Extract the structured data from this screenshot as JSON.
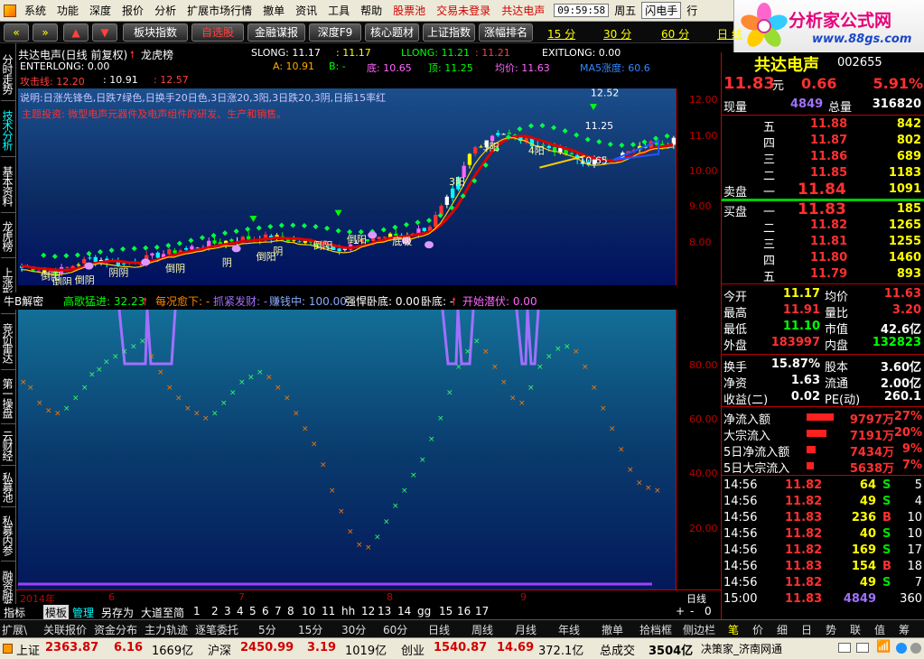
{
  "menubar": {
    "items": [
      "系统",
      "功能",
      "深度",
      "报价",
      "分析",
      "扩展市场行情",
      "撤单",
      "资讯",
      "工具",
      "帮助"
    ],
    "right_items": [
      "股票池",
      "交易未登录",
      "共达电声"
    ],
    "clock": "09:59:58",
    "weekday": "周五",
    "flash": "闪电手",
    "extra": "行"
  },
  "logo": {
    "title": "分析家公式网",
    "url": "www.88gs.com"
  },
  "toolbar": {
    "buttons": [
      "板块指数",
      "自选股",
      "金融谋报",
      "深度F9",
      "核心题材",
      "上证指数",
      "涨幅排名"
    ],
    "periods": [
      "15 分",
      "30 分",
      "60 分",
      "日 线"
    ]
  },
  "left_tabs": [
    "分时走势",
    "技术分析",
    "基本资料",
    "龙虎榜",
    "上涨形态",
    "竞价雷达",
    "第一操盘",
    "云财经",
    "私募池",
    "私募内参",
    "融资融券"
  ],
  "chart_header": {
    "title": "共达电声(日线 前复权)",
    "tag": "龙虎榜",
    "enterlong": "ENTERLONG: 0.00",
    "slong": "SLONG: 11.17",
    "slong2": ": 11.17",
    "llong": "LLONG: 11.21",
    "llong2": ": 11.21",
    "exitlong": "EXITLONG: 0.00",
    "atk": "攻击线: 12.20",
    "atk2": ": 10.91",
    "atk3": ": 12.57",
    "a": "A: 10.91",
    "b": "B: -",
    "low": "底: 10.65",
    "top": "顶: 11.25",
    "avg": "均价: 11.63",
    "ma5": "MA5涨度: 60.6",
    "note1": "说明:日涨先锋色,日跌7绿色,日换手20日色,3日涨20,3阳,3日跌20,3阴,日振15率红",
    "note2": "主题投资: 微型电声元器件及电声组件的研发、生产和销售。",
    "k_labels": [
      "倒阳",
      "阴阴",
      "倒阴",
      "倒阴",
      "倒阴",
      "阴",
      "倒阳",
      "阴",
      "倒阳",
      "倒阳",
      "底吸",
      "3阳",
      "3阳",
      "4阳",
      "11.25",
      "10.65",
      "12.52"
    ]
  },
  "indicator_bar": {
    "name": "牛B解密",
    "f1": "高歌猛进: 32.23",
    "f2": "每况愈下: -",
    "f3": "抓紧发财: -",
    "f4": "赚钱中: 100.00",
    "f5": "强悍卧底: 0.00",
    "f6": "卧底: -",
    "f7": "开始潜伏: 0.00"
  },
  "axis_k": [
    "12.00",
    "11.00",
    "10.00",
    "9.00",
    "8.00"
  ],
  "axis_ind": [
    "80.00",
    "60.00",
    "40.00",
    "20.00"
  ],
  "date_axis": [
    "2014年",
    "6",
    "7",
    "8",
    "9"
  ],
  "date_axis_right": "日线",
  "template_bar": {
    "items": [
      "指标",
      "模板",
      "管理",
      "另存为",
      "大道至简",
      "1",
      "2",
      "3",
      "4",
      "5",
      "6",
      "7",
      "8",
      "10",
      "11",
      "hh",
      "12",
      "13",
      "14",
      "gg",
      "15",
      "16",
      "17"
    ],
    "right": [
      "+",
      "-",
      "0"
    ]
  },
  "bottom_tabs": {
    "items": [
      "扩展\\",
      "关联报价",
      "资金分布",
      "主力轨迹",
      "逐笔委托",
      "5分",
      "15分",
      "30分",
      "60分",
      "日线",
      "周线",
      "月线",
      "年线",
      "撤单",
      "拾档框",
      "侧边栏"
    ],
    "right": [
      "笔",
      "价",
      "细",
      "日",
      "势",
      "联",
      "值",
      "筹"
    ]
  },
  "status_bar": {
    "sh_label": "上证",
    "sh_val": "2363.87",
    "sh_chg": "6.16",
    "sh_amt": "1669亿",
    "hs_label": "沪深",
    "hs_val": "2450.99",
    "hs_chg": "3.19",
    "hs_amt": "1019亿",
    "cy_label": "创业",
    "cy_val": "1540.87",
    "cy_chg": "14.69",
    "cy_amt": "372.1亿",
    "total_label": "总成交",
    "total_amt": "3504亿",
    "broker": "决策家_济南网通"
  },
  "quote": {
    "name": "共达电声",
    "code": "002655",
    "price": "11.83",
    "unit": "元",
    "change": "0.66",
    "pct": "5.91%",
    "now_vol_label": "现量",
    "now_vol": "4849",
    "total_vol_label": "总量",
    "total_vol": "316820",
    "asks": [
      {
        "label": "五",
        "price": "11.88",
        "vol": "842"
      },
      {
        "label": "四",
        "price": "11.87",
        "vol": "802"
      },
      {
        "label": "三",
        "price": "11.86",
        "vol": "689"
      },
      {
        "label": "二",
        "price": "11.85",
        "vol": "1183"
      },
      {
        "label": "一",
        "price": "11.84",
        "vol": "1091"
      }
    ],
    "ask_head": "卖盘",
    "bid_head": "买盘",
    "bids": [
      {
        "label": "一",
        "price": "11.83",
        "vol": "185"
      },
      {
        "label": "二",
        "price": "11.82",
        "vol": "1265"
      },
      {
        "label": "三",
        "price": "11.81",
        "vol": "1255"
      },
      {
        "label": "四",
        "price": "11.80",
        "vol": "1460"
      },
      {
        "label": "五",
        "price": "11.79",
        "vol": "893"
      }
    ],
    "stats": [
      [
        "今开",
        "11.17",
        "均价",
        "11.63"
      ],
      [
        "最高",
        "11.91",
        "量比",
        "3.20"
      ],
      [
        "最低",
        "11.10",
        "市值",
        "42.6亿"
      ],
      [
        "外盘",
        "183997",
        "内盘",
        "132823"
      ],
      [
        "换手",
        "15.87%",
        "股本",
        "3.60亿"
      ],
      [
        "净资",
        "1.63",
        "流通",
        "2.00亿"
      ],
      [
        "收益(二)",
        "0.02",
        "PE(动)",
        "260.1"
      ]
    ],
    "flows": [
      {
        "label": "净流入额",
        "val": "9797万",
        "pct": "27%",
        "frac": 0.27
      },
      {
        "label": "大宗流入",
        "val": "7191万",
        "pct": "20%",
        "frac": 0.2
      },
      {
        "label": "5日净流入额",
        "val": "7434万",
        "pct": "9%",
        "frac": 0.09
      },
      {
        "label": "5日大宗流入",
        "val": "5638万",
        "pct": "7%",
        "frac": 0.07
      }
    ],
    "ticks": [
      {
        "t": "14:56",
        "p": "11.82",
        "v": "64",
        "bs": "S",
        "n": "5"
      },
      {
        "t": "14:56",
        "p": "11.82",
        "v": "49",
        "bs": "S",
        "n": "4"
      },
      {
        "t": "14:56",
        "p": "11.83",
        "v": "236",
        "bs": "B",
        "n": "10"
      },
      {
        "t": "14:56",
        "p": "11.82",
        "v": "40",
        "bs": "S",
        "n": "10"
      },
      {
        "t": "14:56",
        "p": "11.82",
        "v": "169",
        "bs": "S",
        "n": "17"
      },
      {
        "t": "14:56",
        "p": "11.83",
        "v": "154",
        "bs": "B",
        "n": "18"
      },
      {
        "t": "14:56",
        "p": "11.82",
        "v": "49",
        "bs": "S",
        "n": "7"
      },
      {
        "t": "15:00",
        "p": "11.83",
        "v": "4849",
        "bs": "",
        "n": "360"
      }
    ]
  },
  "colors": {
    "up": "#ff3030",
    "down": "#00e000",
    "gold": "#ffff00",
    "cyan": "#00ffff",
    "purple": "#a070ff"
  }
}
